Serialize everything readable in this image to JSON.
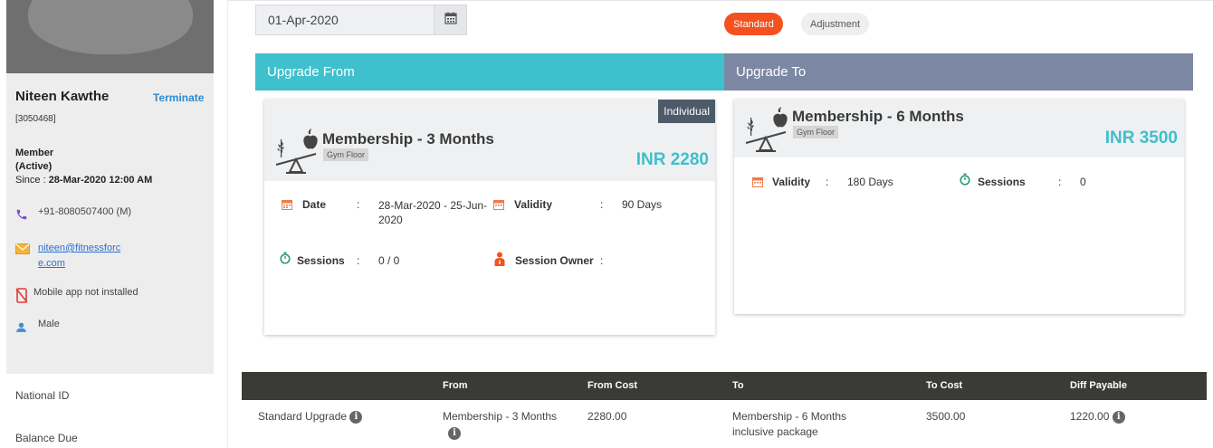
{
  "member": {
    "name": "Niteen Kawthe",
    "terminate_label": "Terminate",
    "id": "[3050468]",
    "type": "Member",
    "status": "(Active)",
    "since_label": "Since : ",
    "since_value": "28-Mar-2020 12:00 AM",
    "phone": "+91-8080507400 (M)",
    "email_line1": "niteen@fitnessforc",
    "email_line2": "e.com",
    "app_status": "Mobile app not installed",
    "gender": "Male"
  },
  "sidebar_fields": {
    "national_id": "National ID",
    "balance_due": "Balance Due"
  },
  "date_picker": {
    "value": "01-Apr-2020"
  },
  "mode_toggle": {
    "standard": "Standard",
    "adjustment": "Adjustment"
  },
  "upgrade_from": {
    "header": "Upgrade From",
    "badge": "Individual",
    "plan_name": "Membership - 3 Months",
    "tag": "Gym Floor",
    "price": "INR 2280",
    "date_label": "Date",
    "date_value_line1": "28-Mar-2020 - 25-Jun-",
    "date_value_line2": "2020",
    "validity_label": "Validity",
    "validity_value": "90 Days",
    "sessions_label": "Sessions",
    "sessions_value": "0 / 0",
    "owner_label": "Session Owner",
    "colon": ":"
  },
  "upgrade_to": {
    "header": "Upgrade To",
    "plan_name": "Membership - 6 Months",
    "tag": "Gym Floor",
    "price": "INR 3500",
    "validity_label": "Validity",
    "validity_value": "180 Days",
    "sessions_label": "Sessions",
    "sessions_value": "0",
    "colon": ":"
  },
  "table": {
    "headers": [
      "From",
      "From Cost",
      "To",
      "To Cost",
      "Diff Payable"
    ],
    "row": {
      "type": "Standard Upgrade",
      "from": "Membership - 3 Months",
      "from_cost": "2280.00",
      "to_line1": "Membership - 6 Months",
      "to_line2": "inclusive package",
      "to_cost": "3500.00",
      "diff": "1220.00"
    }
  },
  "colors": {
    "accent_orange": "#f4511e",
    "teal": "#3fc0cd",
    "slate": "#7c88a3"
  }
}
